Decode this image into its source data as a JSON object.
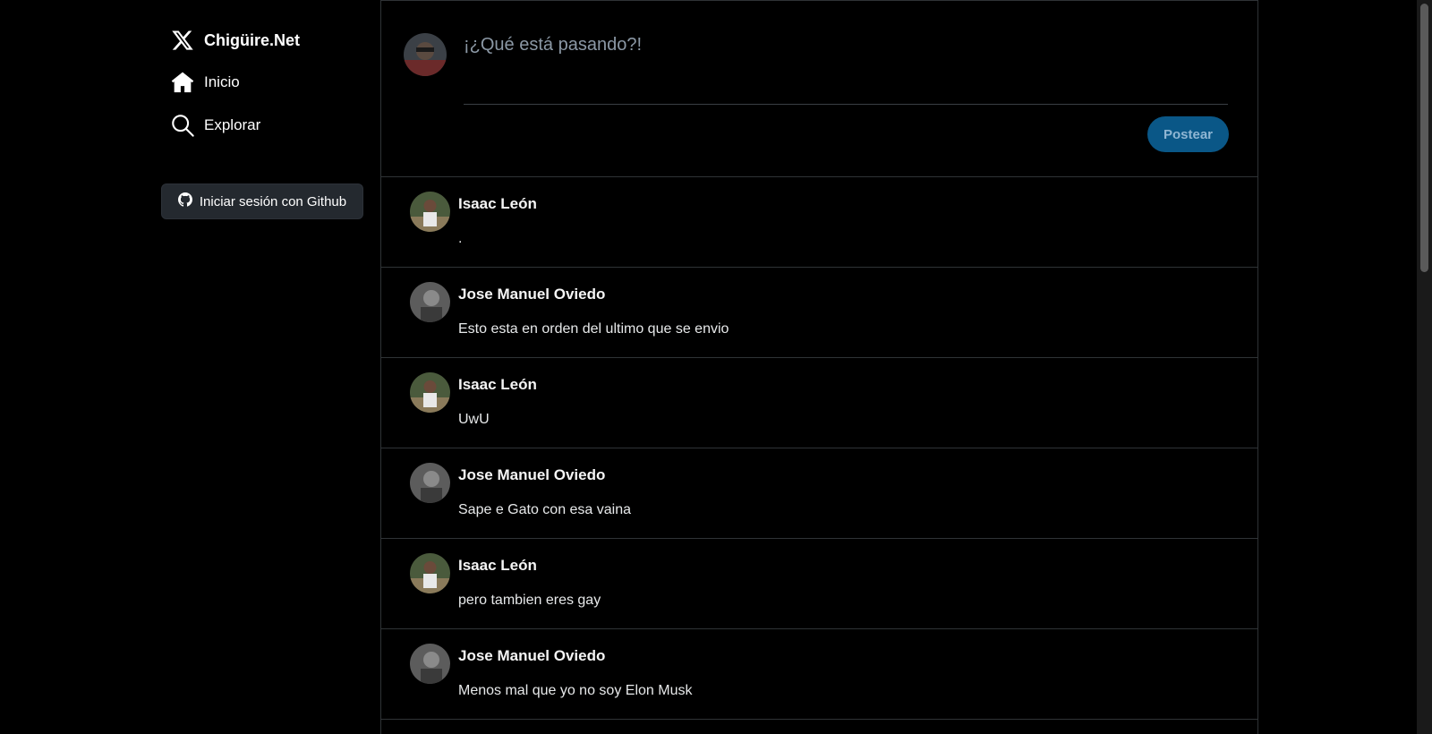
{
  "sidebar": {
    "brand": {
      "label": "Chigüire.Net",
      "icon": "x-logo-icon"
    },
    "items": [
      {
        "label": "Inicio",
        "icon": "home-icon"
      },
      {
        "label": "Explorar",
        "icon": "search-icon"
      }
    ],
    "login_label": "Iniciar sesión con Github"
  },
  "composer": {
    "placeholder": "¡¿Qué está pasando?!",
    "post_label": "Postear"
  },
  "posts": [
    {
      "author": "Isaac León",
      "content": "."
    },
    {
      "author": "Jose Manuel Oviedo",
      "content": "Esto esta en orden del ultimo que se envio"
    },
    {
      "author": "Isaac León",
      "content": "UwU"
    },
    {
      "author": "Jose Manuel Oviedo",
      "content": "Sape e Gato con esa vaina"
    },
    {
      "author": "Isaac León",
      "content": "pero tambien eres gay"
    },
    {
      "author": "Jose Manuel Oviedo",
      "content": "Menos mal que yo no soy Elon Musk"
    }
  ],
  "colors": {
    "background": "#000000",
    "border": "#2f3336",
    "post_button": "#0a5787",
    "login_button": "#24292f"
  }
}
